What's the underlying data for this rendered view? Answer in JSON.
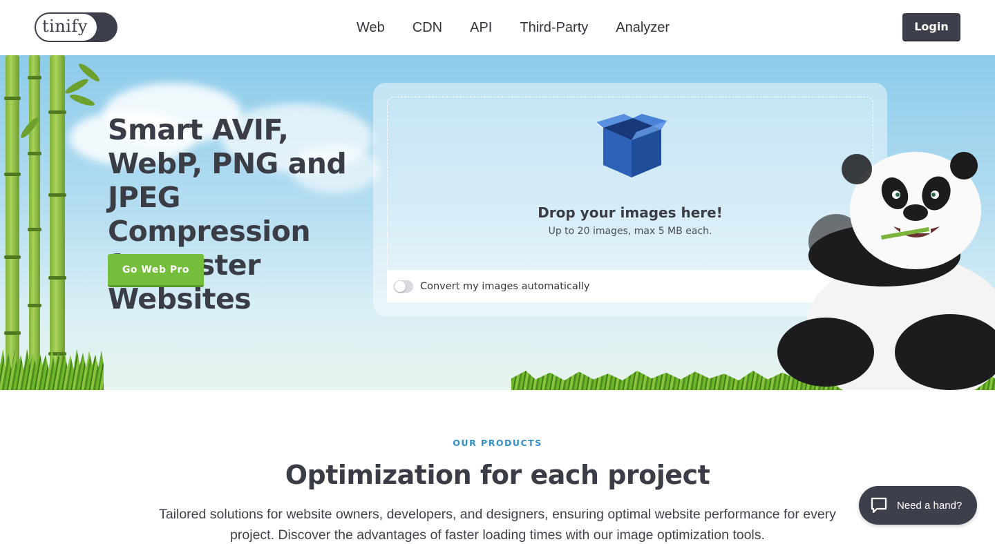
{
  "header": {
    "logo_text": "tinify",
    "nav": [
      "Web",
      "CDN",
      "API",
      "Third-Party",
      "Analyzer"
    ],
    "login_label": "Login"
  },
  "hero": {
    "title": "Smart AVIF, WebP, PNG and JPEG Compression for Faster Websites",
    "cta_label": "Go Web Pro",
    "dropzone": {
      "title": "Drop your images here!",
      "subtitle": "Up to 20 images, max 5 MB each."
    },
    "convert_label": "Convert my images automatically",
    "convert_enabled": false
  },
  "products": {
    "eyebrow": "OUR PRODUCTS",
    "title": "Optimization for each project",
    "description": "Tailored solutions for website owners, developers, and designers, ensuring optimal website performance for every project. Discover the advantages of faster loading times with our image optimization tools."
  },
  "help": {
    "label": "Need a hand?"
  },
  "colors": {
    "brand_dark": "#3d404a",
    "cta_green": "#75be3c",
    "accent_blue": "#2f8fc6"
  },
  "icons": [
    "box-icon",
    "chat-bubble-icon",
    "panda-mascot"
  ]
}
